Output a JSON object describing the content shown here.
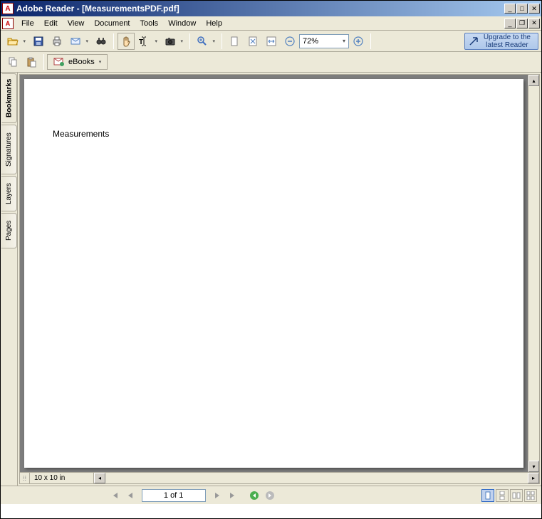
{
  "window": {
    "title": "Adobe Reader - [MeasurementsPDF.pdf]"
  },
  "menu": {
    "file": "File",
    "edit": "Edit",
    "view": "View",
    "document": "Document",
    "tools": "Tools",
    "window": "Window",
    "help": "Help"
  },
  "toolbar": {
    "zoom_value": "72%",
    "upgrade_line1": "Upgrade to the",
    "upgrade_line2": "latest Reader",
    "ebooks_label": "eBooks"
  },
  "nav_tabs": {
    "bookmarks": "Bookmarks",
    "signatures": "Signatures",
    "layers": "Layers",
    "pages": "Pages"
  },
  "document": {
    "content_text": "Measurements",
    "dimensions": "10 x 10 in"
  },
  "status": {
    "page_indicator": "1 of 1"
  }
}
